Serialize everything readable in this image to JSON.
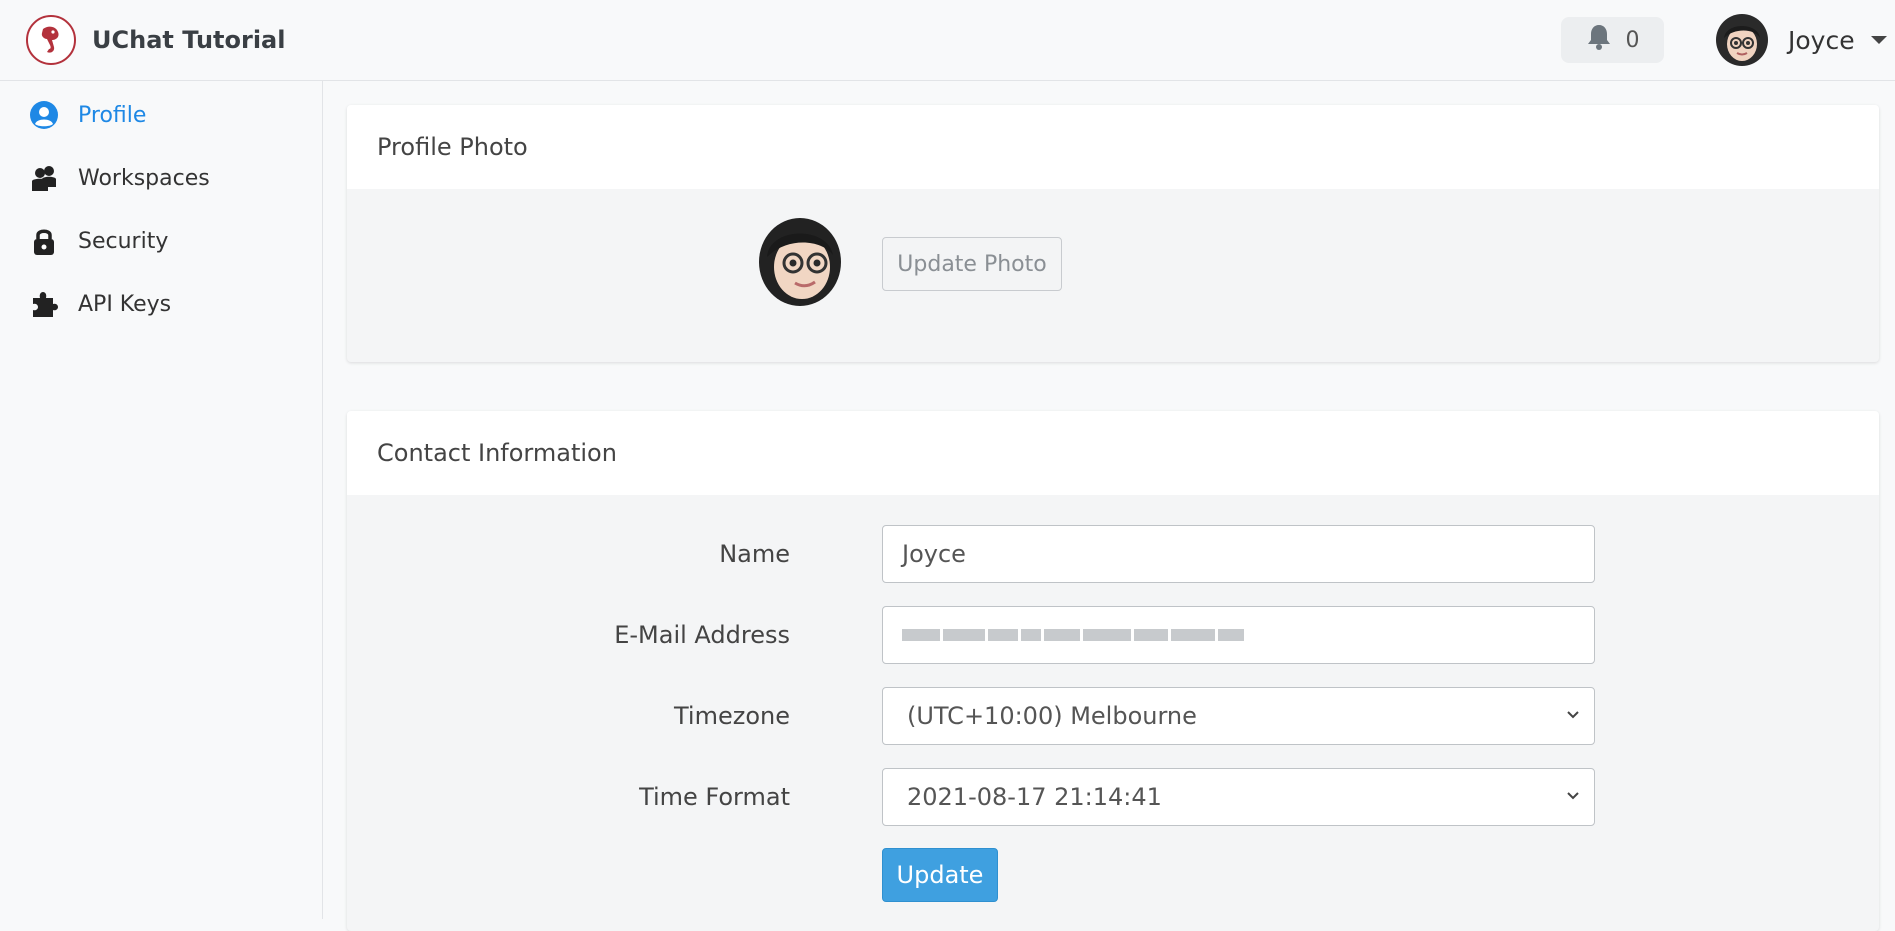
{
  "app": {
    "title": "UChat Tutorial"
  },
  "header": {
    "notifications_count": "0",
    "user_name": "Joyce"
  },
  "sidebar": {
    "items": [
      {
        "label": "Profile",
        "icon": "user-circle-icon",
        "active": true
      },
      {
        "label": "Workspaces",
        "icon": "users-icon",
        "active": false
      },
      {
        "label": "Security",
        "icon": "lock-icon",
        "active": false
      },
      {
        "label": "API Keys",
        "icon": "puzzle-piece-icon",
        "active": false
      }
    ]
  },
  "profile_photo": {
    "title": "Profile Photo",
    "button_label": "Update Photo"
  },
  "contact": {
    "title": "Contact Information",
    "name_label": "Name",
    "name_value": "Joyce",
    "email_label": "E-Mail Address",
    "timezone_label": "Timezone",
    "timezone_value": "(UTC+10:00) Melbourne",
    "time_format_label": "Time Format",
    "time_format_value": "2021-08-17 21:14:41",
    "update_label": "Update"
  },
  "colors": {
    "accent": "#1e88e5",
    "primary_button": "#3fa0e0",
    "brand": "#b3323c"
  }
}
